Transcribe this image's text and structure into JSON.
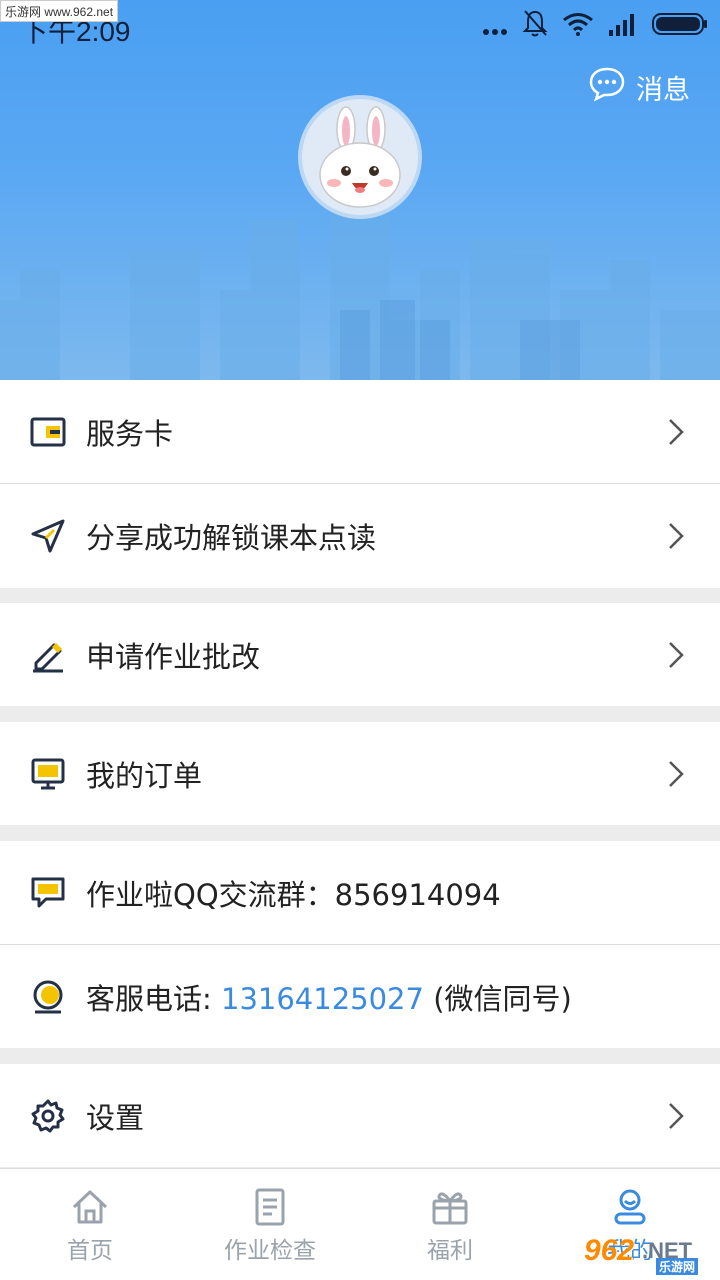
{
  "status_bar": {
    "time": "下午2:09"
  },
  "watermark_top": "乐游网 www.962.net",
  "header": {
    "message_label": "消息"
  },
  "menu": [
    {
      "key": "service_card",
      "label": "服务卡",
      "icon": "card-icon"
    },
    {
      "key": "share_unlock",
      "label": "分享成功解锁课本点读",
      "icon": "send-icon"
    },
    {
      "key": "homework_review",
      "label": "申请作业批改",
      "icon": "pencil-icon"
    },
    {
      "key": "my_orders",
      "label": "我的订单",
      "icon": "monitor-icon"
    },
    {
      "key": "qq_group",
      "label": "作业啦QQ交流群：856914094",
      "icon": "chat-icon"
    },
    {
      "key": "service_phone",
      "label_prefix": "客服电话:",
      "phone": "13164125027",
      "label_suffix": "(微信同号)",
      "icon": "headset-icon"
    },
    {
      "key": "settings",
      "label": "设置",
      "icon": "gear-icon"
    }
  ],
  "bottom_nav": [
    {
      "label": "首页",
      "icon": "home-icon",
      "active": false
    },
    {
      "label": "作业检查",
      "icon": "document-icon",
      "active": false
    },
    {
      "label": "福利",
      "icon": "gift-icon",
      "active": false
    },
    {
      "label": "我的",
      "icon": "profile-icon",
      "active": true
    }
  ],
  "watermark_bottom": {
    "brand": "962",
    "suffix": ".NET",
    "sub": "乐游网"
  },
  "colors": {
    "header_blue": "#4a9ff2",
    "accent_blue": "#3a8be0",
    "icon_yellow": "#f5c400",
    "icon_dark": "#243046"
  }
}
